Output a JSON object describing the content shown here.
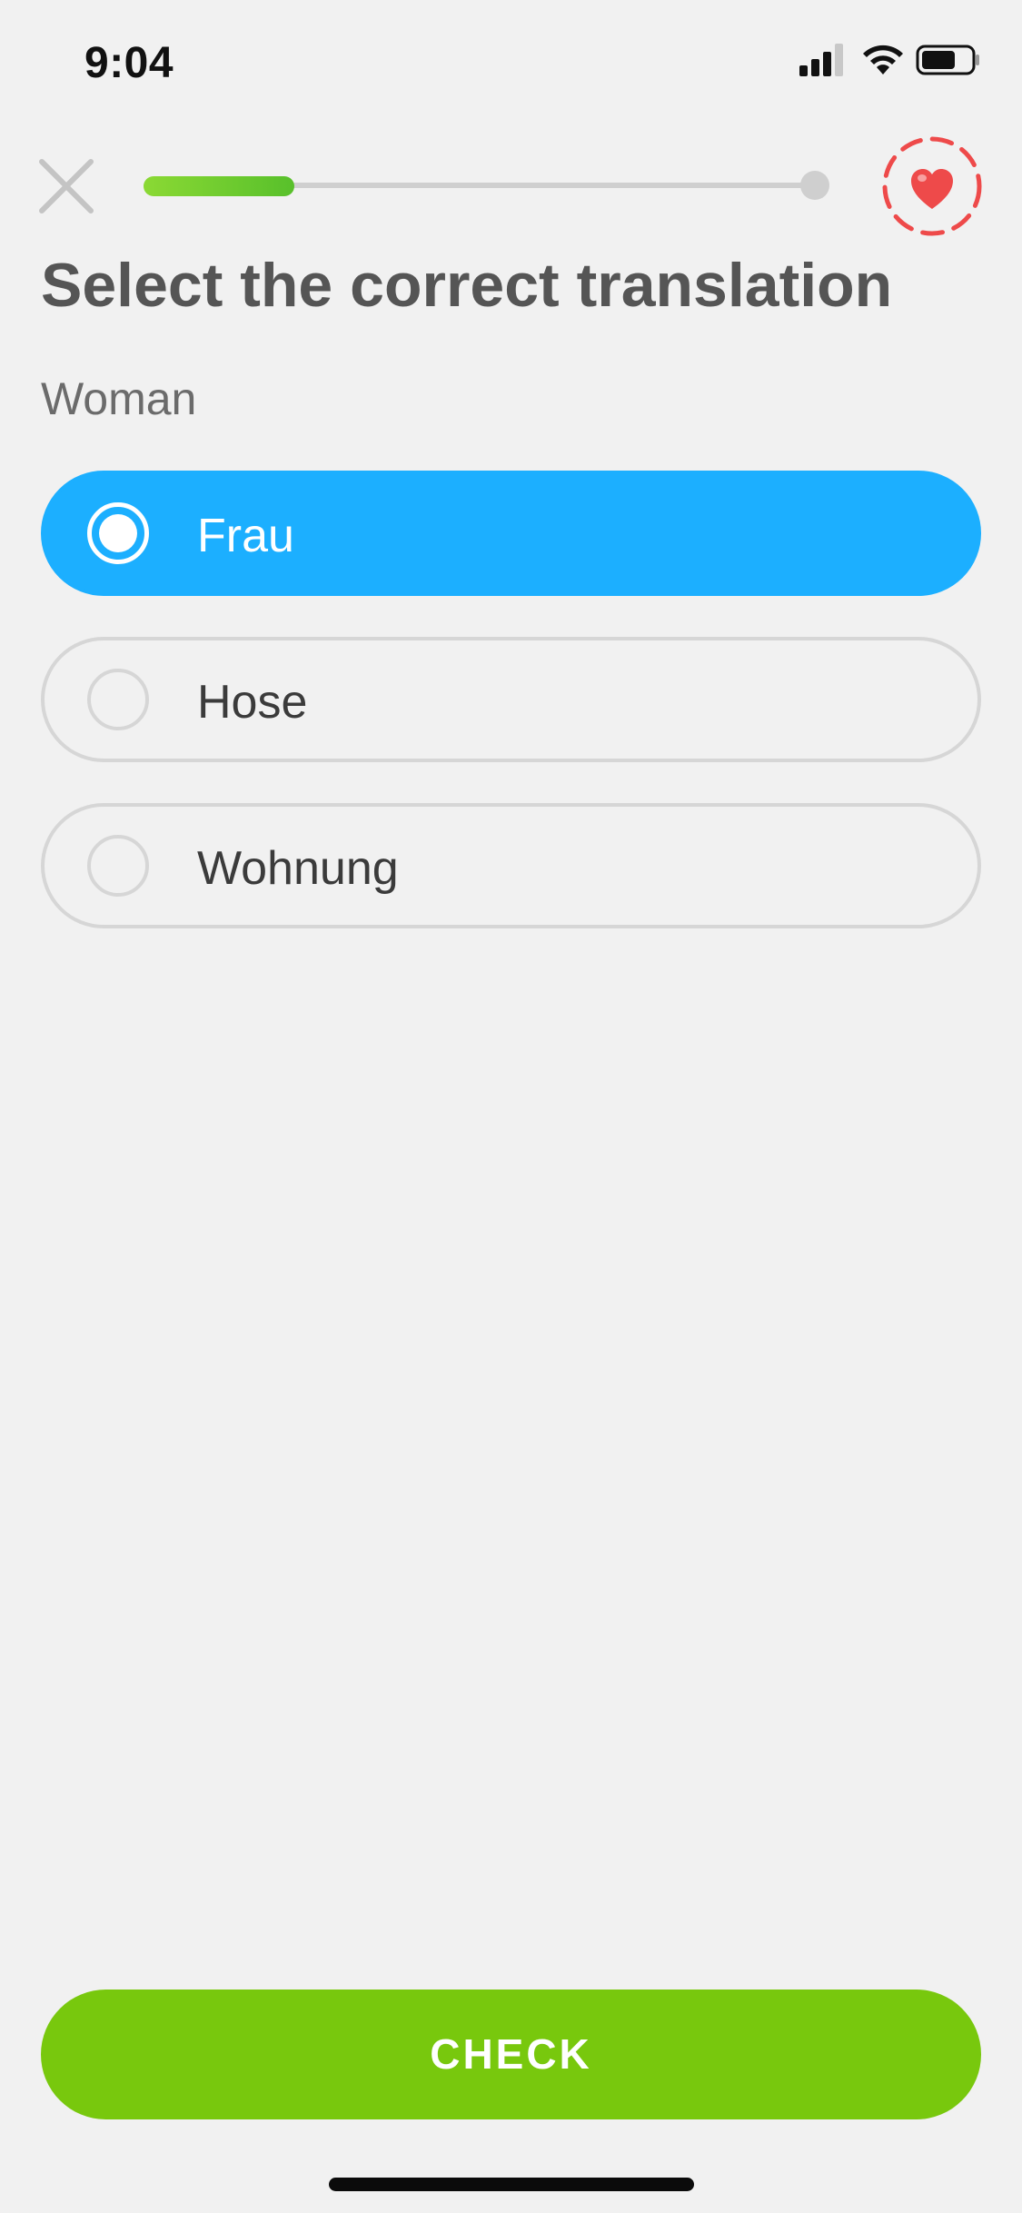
{
  "status_bar": {
    "time": "9:04",
    "icons": [
      "cellular-signal-icon",
      "wifi-icon",
      "battery-icon"
    ]
  },
  "top_bar": {
    "close_icon": "close-icon",
    "progress_fraction": 0.22,
    "heart_icon": "heart-icon"
  },
  "exercise": {
    "title": "Select the correct translation",
    "prompt": "Woman"
  },
  "options": [
    {
      "label": "Frau",
      "selected": true
    },
    {
      "label": "Hose",
      "selected": false
    },
    {
      "label": "Wohnung",
      "selected": false
    }
  ],
  "check_button": {
    "label": "CHECK"
  },
  "colors": {
    "selected_option": "#1cafff",
    "check_button": "#78c80d",
    "progress_fill": "#58c02b",
    "heart": "#ee4a4a"
  }
}
